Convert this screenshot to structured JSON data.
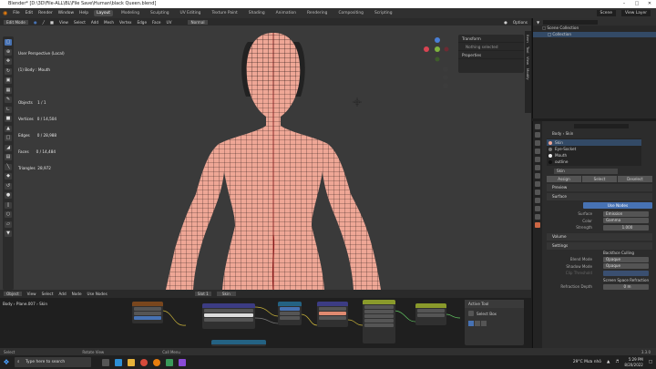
{
  "window": {
    "title": "Blender* [D:\\3D\\File-ALL\\BL\\File Save\\Human\\black Queen.blend]"
  },
  "menu": {
    "items": [
      "File",
      "Edit",
      "Render",
      "Window",
      "Help"
    ],
    "workspaces": [
      "Layout",
      "Modeling",
      "Sculpting",
      "UV Editing",
      "Texture Paint",
      "Shading",
      "Animation",
      "Rendering",
      "Compositing",
      "Scripting"
    ],
    "active_workspace": "Layout",
    "scene": "Scene",
    "view_layer": "View Layer"
  },
  "viewport": {
    "mode": "Edit Mode",
    "menus": [
      "View",
      "Select",
      "Add",
      "Mesh",
      "Vertex",
      "Edge",
      "Face",
      "UV"
    ],
    "orientation": "Normal",
    "options": "Options",
    "overlay_lines": [
      "User Perspective (Local)",
      "(1) Body : Mouth",
      "",
      "Objects    1 / 1",
      "Vertices   0 / 14,504",
      "Edges      0 / 28,988",
      "Faces      0 / 14,484",
      "Triangles  28,972"
    ],
    "npanel": {
      "transform": "Transform",
      "nothing": "Nothing selected",
      "properties": "Properties"
    },
    "npanel_tabs": [
      "Item",
      "Tool",
      "View",
      "Modify"
    ]
  },
  "outliner": {
    "title": "Scene Collection",
    "items": [
      "Collection"
    ]
  },
  "properties": {
    "breadcrumb_object": "Body",
    "breadcrumb_material": "Skin",
    "materials": [
      "Skin",
      "Eye-Socket",
      "Mouth",
      "outline"
    ],
    "material_name": "Skin",
    "buttons": [
      "Assign",
      "Select",
      "Deselect"
    ],
    "preview": "Preview",
    "surface": "Surface",
    "use_nodes": "Use Nodes",
    "surface_rows": [
      {
        "label": "Surface",
        "value": "Emission"
      },
      {
        "label": "Color",
        "value": "Gamma"
      },
      {
        "label": "Strength",
        "value": "1.000"
      }
    ],
    "volume": "Volume",
    "settings": "Settings",
    "settings_rows": [
      {
        "label": "",
        "value": "Backface Culling"
      },
      {
        "label": "Blend Mode",
        "value": "Opaque"
      },
      {
        "label": "Shadow Mode",
        "value": "Opaque"
      },
      {
        "label": "Clip Threshold",
        "value": ""
      },
      {
        "label": "",
        "value": "Screen Space Refraction"
      },
      {
        "label": "Refraction Depth",
        "value": "0 m"
      }
    ]
  },
  "node_editor": {
    "header_items": [
      "Object",
      "View",
      "Select",
      "Add",
      "Node",
      "Use Nodes"
    ],
    "slot": "Slot 1",
    "material": "Skin",
    "breadcrumb": [
      "Body",
      "Plane.007",
      "Skin"
    ],
    "active_tool": {
      "title": "Active Tool",
      "select": "Select Box"
    }
  },
  "statusbar": {
    "items": [
      "Select",
      "Rotate View",
      "Call Menu"
    ],
    "version": "3.3.0"
  },
  "taskbar": {
    "search": "Type here to search",
    "weather": "29°C  Mưa nhỏ",
    "time": "5:29 PM",
    "date": "8/20/2022"
  },
  "colors": {
    "accent": "#4772b3",
    "skin": "#efa796",
    "mesh": "#2b1a17",
    "bg": "#3a3a3a"
  }
}
